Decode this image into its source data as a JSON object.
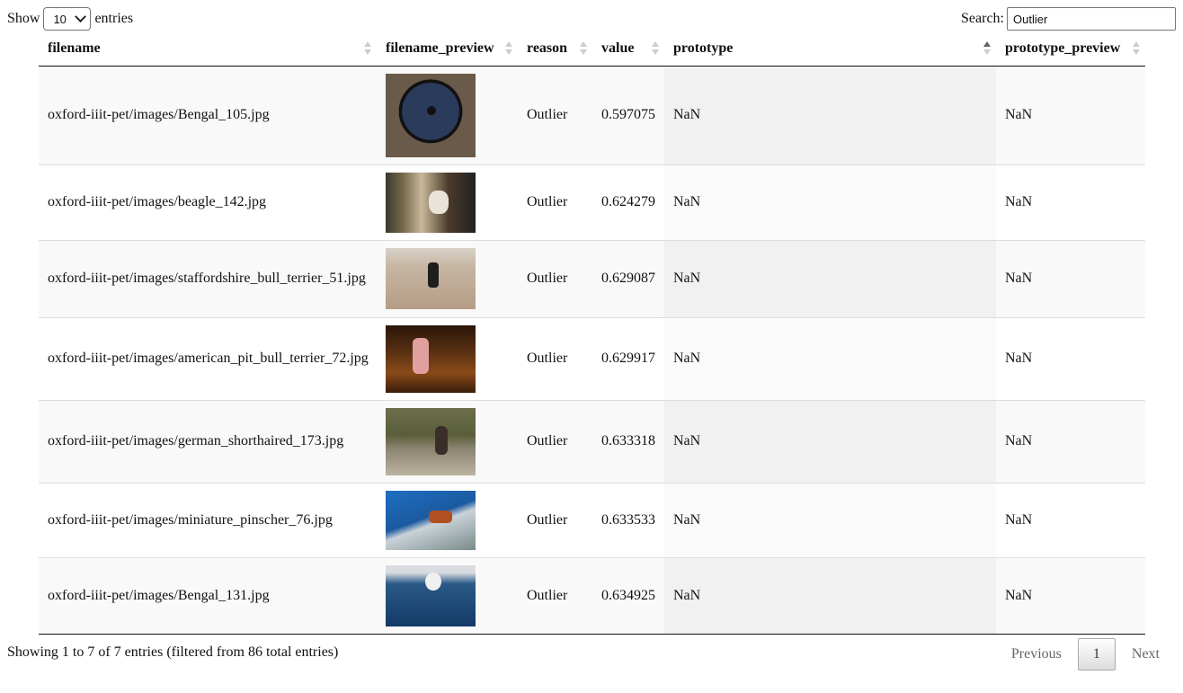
{
  "length": {
    "label_before": "Show",
    "selected": "10",
    "label_after": "entries"
  },
  "search": {
    "label": "Search:",
    "value": "Outlier"
  },
  "columns": [
    "filename",
    "filename_preview",
    "reason",
    "value",
    "prototype",
    "prototype_preview"
  ],
  "rows": [
    {
      "filename": "oxford-iiit-pet/images/Bengal_105.jpg",
      "preview": "cat-thumbnail",
      "reason": "Outlier",
      "value": "0.597075",
      "prototype": "NaN",
      "prototype_preview": "NaN"
    },
    {
      "filename": "oxford-iiit-pet/images/beagle_142.jpg",
      "preview": "dog-thumbnail",
      "reason": "Outlier",
      "value": "0.624279",
      "prototype": "NaN",
      "prototype_preview": "NaN"
    },
    {
      "filename": "oxford-iiit-pet/images/staffordshire_bull_terrier_51.jpg",
      "preview": "dog-thumbnail",
      "reason": "Outlier",
      "value": "0.629087",
      "prototype": "NaN",
      "prototype_preview": "NaN"
    },
    {
      "filename": "oxford-iiit-pet/images/american_pit_bull_terrier_72.jpg",
      "preview": "dog-thumbnail",
      "reason": "Outlier",
      "value": "0.629917",
      "prototype": "NaN",
      "prototype_preview": "NaN"
    },
    {
      "filename": "oxford-iiit-pet/images/german_shorthaired_173.jpg",
      "preview": "dog-thumbnail",
      "reason": "Outlier",
      "value": "0.633318",
      "prototype": "NaN",
      "prototype_preview": "NaN"
    },
    {
      "filename": "oxford-iiit-pet/images/miniature_pinscher_76.jpg",
      "preview": "dog-thumbnail",
      "reason": "Outlier",
      "value": "0.633533",
      "prototype": "NaN",
      "prototype_preview": "NaN"
    },
    {
      "filename": "oxford-iiit-pet/images/Bengal_131.jpg",
      "preview": "cat-thumbnail",
      "reason": "Outlier",
      "value": "0.634925",
      "prototype": "NaN",
      "prototype_preview": "NaN"
    }
  ],
  "info": "Showing 1 to 7 of 7 entries (filtered from 86 total entries)",
  "pagination": {
    "previous": "Previous",
    "current": "1",
    "next": "Next"
  }
}
